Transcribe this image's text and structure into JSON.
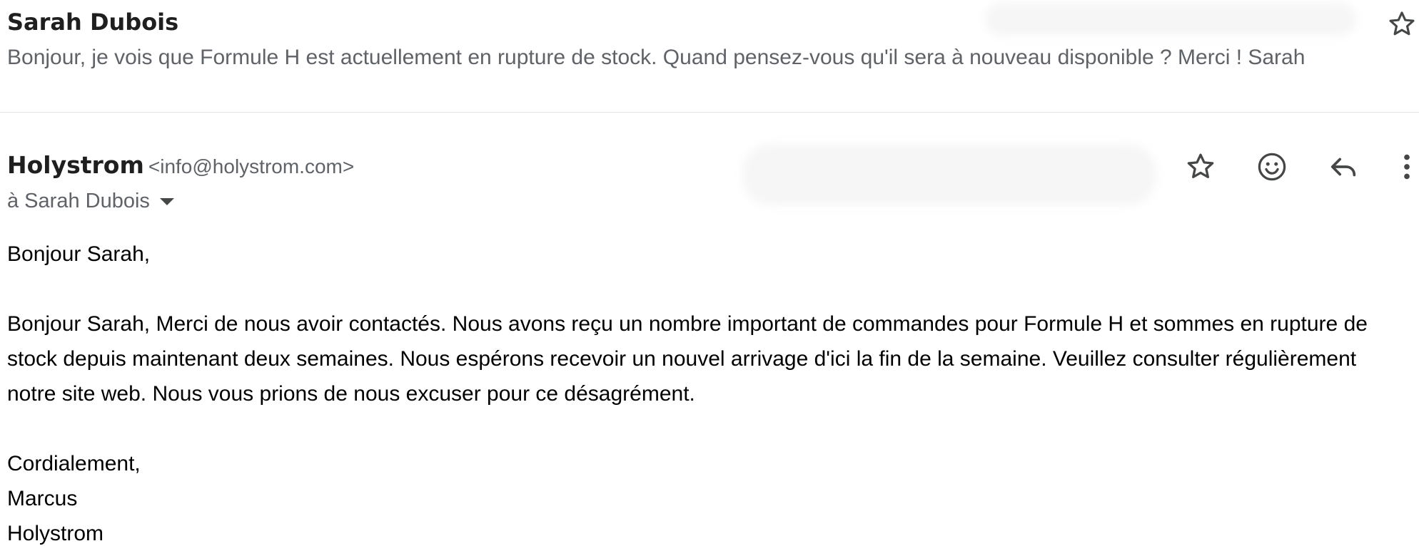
{
  "collapsed_message": {
    "sender": "Sarah Dubois",
    "snippet": "Bonjour, je vois que Formule H est actuellement en rupture de stock. Quand pensez-vous qu'il sera à nouveau disponible ? Merci ! Sarah",
    "star_icon": "star-outline-icon"
  },
  "open_message": {
    "sender_name": "Holystrom",
    "sender_email": "<info@holystrom.com>",
    "recipient": "à Sarah Dubois",
    "actions": [
      {
        "icon": "star-outline-icon",
        "label": "Star"
      },
      {
        "icon": "emoji-smile-icon",
        "label": "React"
      },
      {
        "icon": "reply-icon",
        "label": "Reply"
      },
      {
        "icon": "more-vertical-icon",
        "label": "More"
      }
    ],
    "body": {
      "greeting": "Bonjour Sarah,",
      "paragraph": "Bonjour Sarah, Merci de nous avoir contactés. Nous avons reçu un nombre important de commandes pour Formule H et sommes en rupture de stock depuis maintenant deux semaines. Nous espérons recevoir un nouvel arrivage d'ici la fin de la semaine. Veuillez consulter régulièrement notre site web. Nous vous prions de nous excuser pour ce désagrément.",
      "closing": "Cordialement,",
      "signature_name": "Marcus",
      "signature_company": "Holystrom"
    }
  }
}
